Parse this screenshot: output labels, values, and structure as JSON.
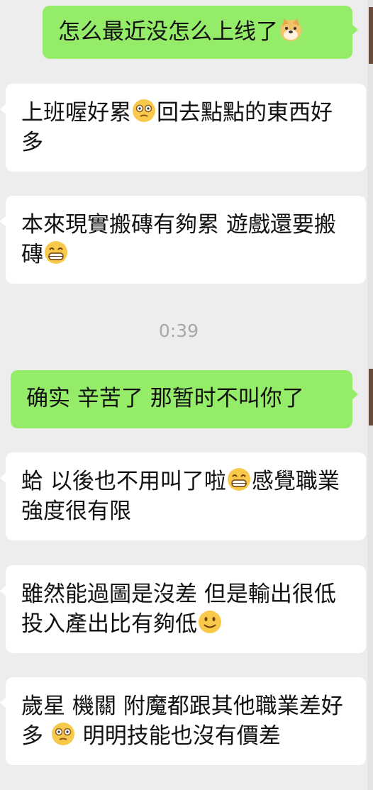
{
  "messages": [
    {
      "side": "right",
      "text": "怎么最近没怎么上线了",
      "emoji": "doge"
    },
    {
      "side": "left",
      "text": "上班喔好累",
      "emoji": "dizzy-face",
      "text2": "回去點點的東西好多"
    },
    {
      "side": "left",
      "text": "本來現實搬磚有夠累 遊戲還要搬磚",
      "emoji": "grin"
    },
    {
      "side": "right",
      "text": "确实 辛苦了 那暂时不叫你了"
    },
    {
      "side": "left",
      "text": "蛤 以後也不用叫了啦",
      "emoji": "grin",
      "text2": "感覺職業強度很有限"
    },
    {
      "side": "left",
      "text": "雖然能過圖是沒差 但是輸出很低 投入產出比有夠低",
      "emoji": "smile"
    },
    {
      "side": "left",
      "text": "歲星 機關 附魔都跟其他職業差好多 ",
      "emoji": "dizzy-face",
      "text2": " 明明技能也沒有價差"
    }
  ],
  "timestamp": "0:39",
  "colors": {
    "background": "#ededed",
    "sent_bubble": "#95ec69",
    "received_bubble": "#ffffff"
  }
}
